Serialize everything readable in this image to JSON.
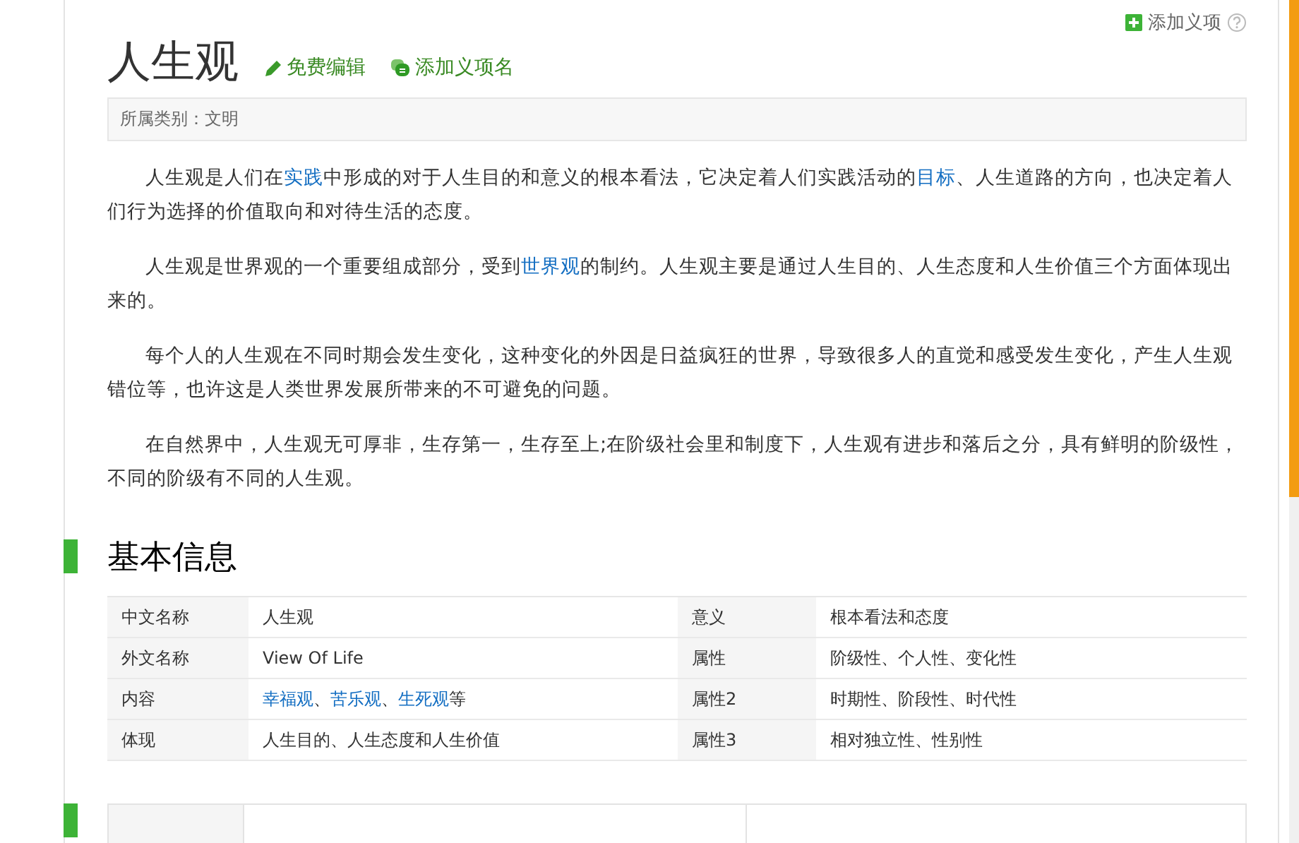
{
  "header": {
    "title": "人生观",
    "edit_link": "免费编辑",
    "add_name_link": "添加义项名",
    "add_item": "添加义项"
  },
  "category": "所属类别：文明",
  "paragraphs": [
    [
      {
        "text": "人生观是人们在",
        "link": false
      },
      {
        "text": "实践",
        "link": true
      },
      {
        "text": "中形成的对于人生目的和意义的根本看法，它决定着人们实践活动的",
        "link": false
      },
      {
        "text": "目标",
        "link": true
      },
      {
        "text": "、人生道路的方向，也决定着人们行为选择的价值取向和对待生活的态度。",
        "link": false
      }
    ],
    [
      {
        "text": "人生观是世界观的一个重要组成部分，受到",
        "link": false
      },
      {
        "text": "世界观",
        "link": true
      },
      {
        "text": "的制约。人生观主要是通过人生目的、人生态度和人生价值三个方面体现出来的。",
        "link": false
      }
    ],
    [
      {
        "text": "每个人的人生观在不同时期会发生变化，这种变化的外因是日益疯狂的世界，导致很多人的直觉和感受发生变化，产生人生观错位等，也许这是人类世界发展所带来的不可避免的问题。",
        "link": false
      }
    ],
    [
      {
        "text": "在自然界中，人生观无可厚非，生存第一，生存至上;在阶级社会里和制度下，人生观有进步和落后之分，具有鲜明的阶级性，不同的阶级有不同的人生观。",
        "link": false
      }
    ]
  ],
  "basic_info": {
    "title": "基本信息",
    "rows": [
      [
        {
          "label": "中文名称",
          "value": [
            {
              "text": "人生观",
              "link": false
            }
          ]
        },
        {
          "label": "意义",
          "value": [
            {
              "text": "根本看法和态度",
              "link": false
            }
          ]
        }
      ],
      [
        {
          "label": "外文名称",
          "value": [
            {
              "text": "View Of Life",
              "link": false
            }
          ]
        },
        {
          "label": "属性",
          "value": [
            {
              "text": "阶级性、个人性、变化性",
              "link": false
            }
          ]
        }
      ],
      [
        {
          "label": "内容",
          "value": [
            {
              "text": "幸福观",
              "link": true
            },
            {
              "text": "、",
              "link": false
            },
            {
              "text": "苦乐观",
              "link": true
            },
            {
              "text": "、",
              "link": false
            },
            {
              "text": "生死观",
              "link": true
            },
            {
              "text": "等",
              "link": false
            }
          ]
        },
        {
          "label": "属性2",
          "value": [
            {
              "text": "时期性、阶段性、时代性",
              "link": false
            }
          ]
        }
      ],
      [
        {
          "label": "体现",
          "value": [
            {
              "text": "人生目的、人生态度和人生价值",
              "link": false
            }
          ]
        },
        {
          "label": "属性3",
          "value": [
            {
              "text": "相对独立性、性别性",
              "link": false
            }
          ]
        }
      ]
    ]
  }
}
